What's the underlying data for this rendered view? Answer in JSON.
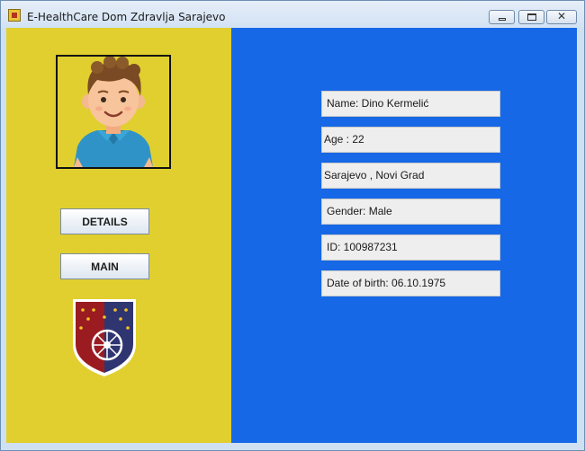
{
  "window": {
    "title": "E-HealthCare Dom Zdravlja Sarajevo",
    "close_glyph": "✕"
  },
  "sidebar": {
    "avatar_icon": "patient-avatar",
    "details_label": "DETAILS",
    "main_label": "MAIN",
    "emblem_icon": "sarajevo-coat-of-arms",
    "color": "#E0CF2F"
  },
  "patient": {
    "name": "Name: Dino Kermelić",
    "age": "Age : 22",
    "address": "Sarajevo , Novi Grad",
    "gender": "Gender: Male",
    "id": "ID: 100987231",
    "dob": "Date of birth: 06.10.1975"
  },
  "colors": {
    "info_panel": "#1668E6",
    "field_background": "#EEEEEE"
  }
}
